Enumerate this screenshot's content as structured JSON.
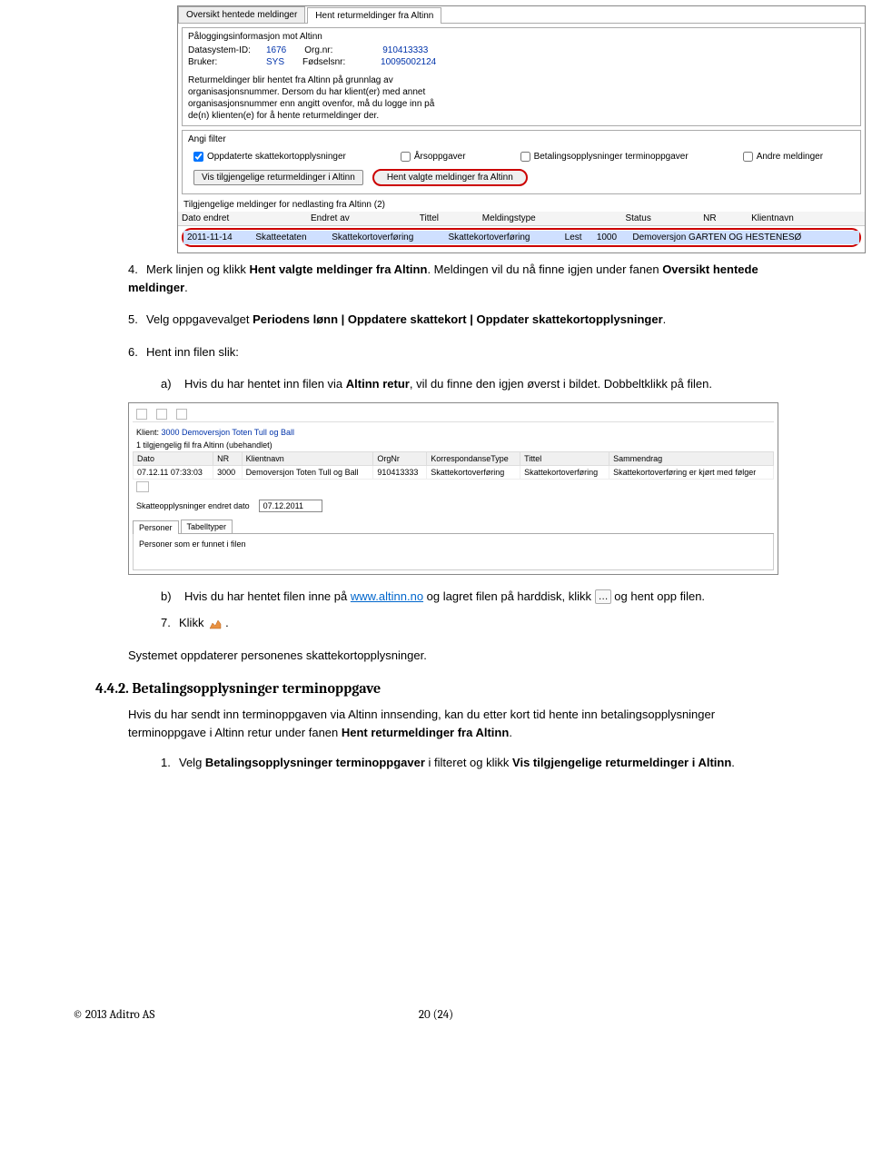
{
  "shot1": {
    "tabs": [
      "Oversikt hentede meldinger",
      "Hent returmeldinger fra Altinn"
    ],
    "section1_title": "Påloggingsinformasjon mot Altinn",
    "kv": {
      "datasystem_k": "Datasystem-ID:",
      "datasystem_v": "1676",
      "orgnr_k": "Org.nr:",
      "orgnr_v": "910413333",
      "bruker_k": "Bruker:",
      "bruker_v": "SYS",
      "fodsel_k": "Fødselsnr:",
      "fodsel_v": "10095002124"
    },
    "infotext": "Returmeldinger blir hentet fra Altinn på grunnlag av organisasjonsnummer. Dersom du har klient(er) med annet organisasjonsnummer enn angitt ovenfor, må du logge inn på de(n) klienten(e) for å hente returmeldinger der.",
    "filter_title": "Angi filter",
    "filters": {
      "f1": "Oppdaterte skattekortopplysninger",
      "f2": "Årsoppgaver",
      "f3": "Betalingsopplysninger terminoppgaver",
      "f4": "Andre meldinger"
    },
    "btn1": "Vis tilgjengelige returmeldinger i Altinn",
    "btn2": "Hent valgte meldinger fra Altinn",
    "gridlabel": "Tilgjengelige meldinger for nedlasting fra Altinn (2)",
    "headers": [
      "Dato endret",
      "Endret av",
      "Tittel",
      "Meldingstype",
      "Status",
      "NR",
      "Klientnavn"
    ],
    "row": [
      "2011-11-14",
      "Skatteetaten",
      "Skattekortoverføring",
      "Skattekortoverføring",
      "Lest",
      "1000",
      "Demoversjon GARTEN OG HESTENESØ"
    ]
  },
  "steps": {
    "s4": {
      "num": "4.",
      "text_a": "Merk linjen og klikk ",
      "bold_a": "Hent valgte meldinger fra Altinn",
      "text_b": ". Meldingen vil du nå finne igjen under fanen ",
      "bold_b": "Oversikt hentede meldinger",
      "text_c": "."
    },
    "s5": {
      "num": "5.",
      "text_a": "Velg oppgavevalget ",
      "bold_a": "Periodens lønn | Oppdatere skattekort | Oppdater skattekortopplysninger",
      "text_b": "."
    },
    "s6": {
      "num": "6.",
      "text_a": "Hent inn filen slik:"
    },
    "s6a": {
      "lbl": "a)",
      "text_a": "Hvis du har hentet inn filen via ",
      "bold_a": "Altinn retur",
      "text_b": ", vil du finne den igjen øverst i bildet. Dobbeltklikk på filen."
    },
    "s6b": {
      "lbl": "b)",
      "text_a": "Hvis du har hentet filen inne på ",
      "link": "www.altinn.no",
      "text_b": " og lagret filen på harddisk, klikk ",
      "text_c": " og hent opp filen."
    },
    "s7": {
      "num": "7.",
      "text_a": "Klikk ",
      "text_b": "."
    },
    "sys": "Systemet oppdaterer personenes skattekortopplysninger."
  },
  "shot2": {
    "klient_k": "Klient:",
    "klient_v": "3000 Demoversjon Toten Tull og Ball",
    "subtitle": "1 tilgjengelig fil fra Altinn (ubehandlet)",
    "headers": [
      "Dato",
      "NR",
      "Klientnavn",
      "OrgNr",
      "KorrespondanseType",
      "Tittel",
      "Sammendrag"
    ],
    "row": [
      "07.12.11 07:33:03",
      "3000",
      "Demoversjon Toten Tull og Ball",
      "910413333",
      "Skattekortoverføring",
      "Skattekortoverføring",
      "Skattekortoverføring er kjørt med følger"
    ],
    "field_k": "Skatteopplysninger endret dato",
    "field_v": "07.12.2011",
    "subtabs": [
      "Personer",
      "Tabelltyper"
    ],
    "panel_text": "Personer som er funnet i filen"
  },
  "h3": "4.4.2. Betalingsopplysninger terminoppgave",
  "para442": {
    "text_a": "Hvis du har sendt inn terminoppgaven via Altinn innsending, kan du etter kort tid hente inn betalingsopplysninger terminoppgave i Altinn retur under fanen ",
    "bold_a": "Hent returmeldinger fra Altinn",
    "text_b": "."
  },
  "step442_1": {
    "num": "1.",
    "text_a": "Velg ",
    "bold_a": "Betalingsopplysninger terminoppgaver",
    "text_b": " i filteret og klikk ",
    "bold_b": "Vis tilgjengelige returmeldinger i Altinn",
    "text_c": "."
  },
  "footer": {
    "page": "20 (24)",
    "copyright": "© 2013 Aditro AS"
  }
}
